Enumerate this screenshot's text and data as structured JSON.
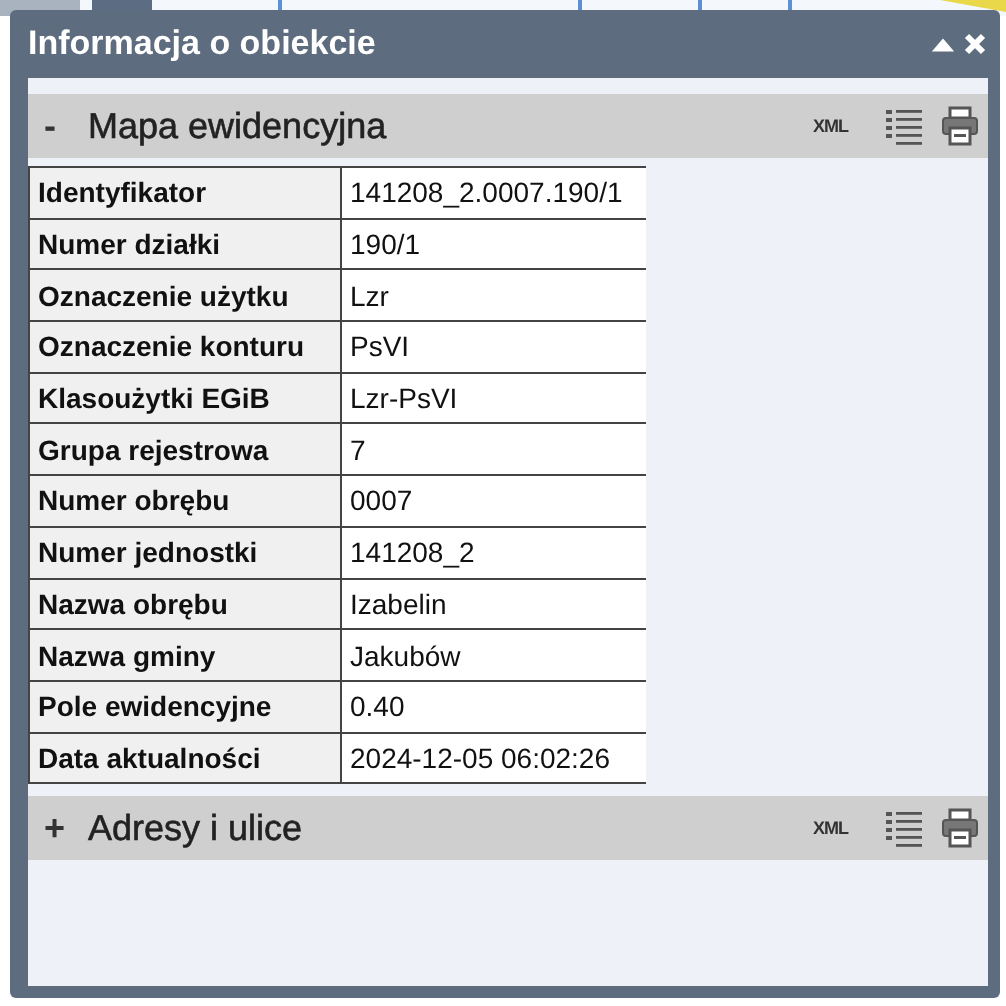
{
  "window": {
    "title": "Informacja o obiekcie"
  },
  "sections": [
    {
      "toggle": "-",
      "title": "Mapa ewidencyjna",
      "xml": "XML",
      "rows": [
        {
          "label": "Identyfikator",
          "value": "141208_2.0007.190/1"
        },
        {
          "label": "Numer działki",
          "value": "190/1"
        },
        {
          "label": "Oznaczenie użytku",
          "value": "Lzr"
        },
        {
          "label": "Oznaczenie konturu",
          "value": "PsVI"
        },
        {
          "label": "Klasoużytki EGiB",
          "value": "Lzr-PsVI"
        },
        {
          "label": "Grupa rejestrowa",
          "value": "7"
        },
        {
          "label": "Numer obrębu",
          "value": "0007"
        },
        {
          "label": "Numer jednostki",
          "value": "141208_2"
        },
        {
          "label": "Nazwa obrębu",
          "value": "Izabelin"
        },
        {
          "label": "Nazwa gminy",
          "value": "Jakubów"
        },
        {
          "label": "Pole ewidencyjne",
          "value": "0.40"
        },
        {
          "label": "Data aktualności",
          "value": "2024-12-05 06:02:26"
        }
      ]
    },
    {
      "toggle": "+",
      "title": "Adresy i ulice",
      "xml": "XML"
    }
  ]
}
